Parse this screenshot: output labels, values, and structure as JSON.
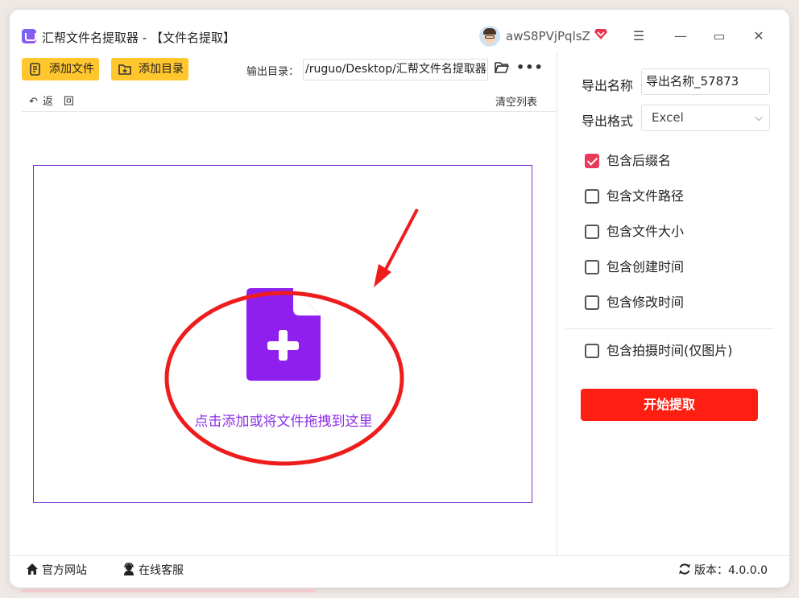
{
  "window": {
    "title": "汇帮文件名提取器 - 【文件名提取】",
    "username": "awS8PVjPqlsZ",
    "controls": {
      "menu": "☰",
      "minimize": "—",
      "maximize": "▭",
      "close": "✕"
    }
  },
  "toolbar": {
    "add_file": "添加文件",
    "add_folder": "添加目录",
    "output_label": "输出目录：",
    "output_path": "/ruguo/Desktop/汇帮文件名提取器",
    "more": "•••",
    "back": "返　回",
    "clear_list": "清空列表"
  },
  "dropzone": {
    "text": "点击添加或将文件拖拽到这里"
  },
  "settings": {
    "export_name_label": "导出名称",
    "export_name_value": "导出名称_57873",
    "export_format_label": "导出格式",
    "export_format_value": "Excel",
    "options": [
      {
        "label": "包含后缀名",
        "checked": true
      },
      {
        "label": "包含文件路径",
        "checked": false
      },
      {
        "label": "包含文件大小",
        "checked": false
      },
      {
        "label": "包含创建时间",
        "checked": false
      },
      {
        "label": "包含修改时间",
        "checked": false
      },
      {
        "label": "包含拍摄时间(仅图片)",
        "checked": false
      }
    ],
    "start_button": "开始提取"
  },
  "footer": {
    "website": "官方网站",
    "support": "在线客服",
    "version": "版本：4.0.0.0"
  },
  "colors": {
    "accent_yellow": "#ffc62d",
    "accent_purple": "#8d30e8",
    "start_red": "#fe1f12",
    "checkbox_pink": "#e93a5a"
  }
}
